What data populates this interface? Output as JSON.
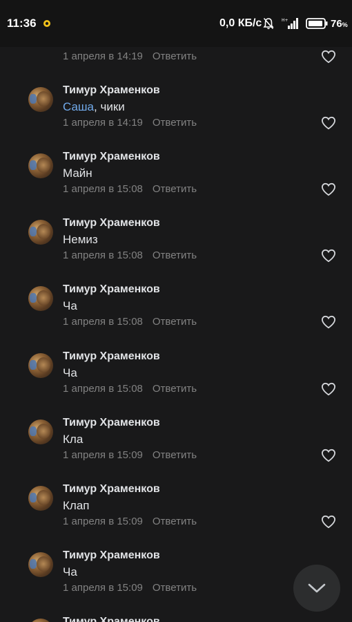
{
  "status_bar": {
    "time": "11:36",
    "network_speed": "0,0 КБ/с",
    "battery_percent": "76",
    "battery_unit": "%",
    "icons": [
      "notification-app-icon",
      "bell-muted-icon",
      "signal-icon",
      "battery-icon"
    ]
  },
  "comments": [
    {
      "author": "",
      "text": "",
      "mention": "",
      "date": "1 апреля в 14:19",
      "reply_label": "Ответить"
    },
    {
      "author": "Тимур Храменков",
      "mention": "Саша",
      "text": ", чики",
      "date": "1 апреля в 14:19",
      "reply_label": "Ответить"
    },
    {
      "author": "Тимур Храменков",
      "mention": "",
      "text": "Майн",
      "date": "1 апреля в 15:08",
      "reply_label": "Ответить"
    },
    {
      "author": "Тимур Храменков",
      "mention": "",
      "text": "Немиз",
      "date": "1 апреля в 15:08",
      "reply_label": "Ответить"
    },
    {
      "author": "Тимур Храменков",
      "mention": "",
      "text": "Ча",
      "date": "1 апреля в 15:08",
      "reply_label": "Ответить"
    },
    {
      "author": "Тимур Храменков",
      "mention": "",
      "text": "Ча",
      "date": "1 апреля в 15:08",
      "reply_label": "Ответить"
    },
    {
      "author": "Тимур Храменков",
      "mention": "",
      "text": "Кла",
      "date": "1 апреля в 15:09",
      "reply_label": "Ответить"
    },
    {
      "author": "Тимур Храменков",
      "mention": "",
      "text": "Клап",
      "date": "1 апреля в 15:09",
      "reply_label": "Ответить"
    },
    {
      "author": "Тимур Храменков",
      "mention": "",
      "text": "Ча",
      "date": "1 апреля в 15:09",
      "reply_label": "Ответить"
    },
    {
      "author": "Тимур Храменков",
      "mention": "",
      "text": "",
      "date": "",
      "reply_label": ""
    }
  ],
  "scroll_button": {
    "icon": "chevron-down-icon"
  },
  "colors": {
    "background": "#19191a",
    "status_bar": "#141414",
    "mention": "#71aaeb",
    "secondary_text": "#828282",
    "scroll_button": "#2c2d2e"
  }
}
